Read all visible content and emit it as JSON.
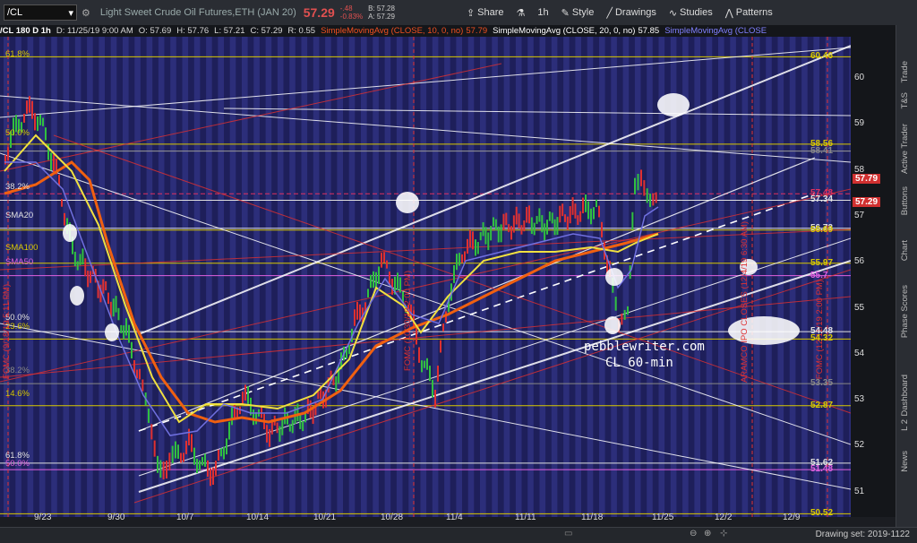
{
  "toolbar": {
    "symbol": "/CL",
    "description": "Light Sweet Crude Oil Futures,ETH (JAN 20)",
    "last": "57.29",
    "change": "-.48",
    "change_pct": "-0.83%",
    "bid": "B: 57.28",
    "ask": "A: 57.29",
    "share": "Share",
    "timeframe": "1h",
    "style": "Style",
    "drawings": "Drawings",
    "studies": "Studies",
    "patterns": "Patterns"
  },
  "infobar": {
    "symbol_tf": "/CL 180 D 1h",
    "date": "D: 11/25/19 9:00 AM",
    "open": "O: 57.69",
    "high": "H: 57.76",
    "low": "L: 57.21",
    "close": "C: 57.29",
    "range": "R: 0.55",
    "sma10": "SimpleMovingAvg (CLOSE, 10, 0, no)",
    "sma10_val": "57.79",
    "sma20": "SimpleMovingAvg (CLOSE, 20, 0, no)",
    "sma20_val": "57.85",
    "sma_next": "SimpleMovingAvg (CLOSE"
  },
  "y_axis": [
    "60",
    "59",
    "58",
    "57",
    "56",
    "55",
    "54",
    "53",
    "52",
    "51"
  ],
  "price_flags": [
    {
      "text": "60.46",
      "color": "#d8c800"
    },
    {
      "text": "58.56",
      "color": "#d8c800"
    },
    {
      "text": "58.41",
      "color": "#888888"
    },
    {
      "text": "57.48",
      "color": "#e03060"
    },
    {
      "text": "57.34",
      "color": "#e0e0e0"
    },
    {
      "text": "57.79",
      "color": "#ffffff",
      "bg": "#d03030"
    },
    {
      "text": "57.29",
      "color": "#ffffff",
      "bg": "#d03030"
    },
    {
      "text": "56.73",
      "color": "#e0e0e0"
    },
    {
      "text": "56.69",
      "color": "#d8c800"
    },
    {
      "text": "55.97",
      "color": "#d8c800"
    },
    {
      "text": "55.7",
      "color": "#e060e0"
    },
    {
      "text": "54.48",
      "color": "#e0e0e0"
    },
    {
      "text": "54.32",
      "color": "#d8c800"
    },
    {
      "text": "53.35",
      "color": "#888888"
    },
    {
      "text": "52.87",
      "color": "#d8c800"
    },
    {
      "text": "51.62",
      "color": "#e0e0e0"
    },
    {
      "text": "51.48",
      "color": "#e060e0"
    },
    {
      "text": "50.52",
      "color": "#d8c800"
    }
  ],
  "x_axis": [
    "9/23",
    "9/30",
    "10/7",
    "10/14",
    "10/21",
    "10/28",
    "11/4",
    "11/11",
    "11/18",
    "11/25",
    "12/2",
    "12/9"
  ],
  "level_labels": [
    {
      "text": "61.8%",
      "color": "#d8c800"
    },
    {
      "text": "50.0%",
      "color": "#d8c800"
    },
    {
      "text": "38.2%",
      "color": "#e0e0e0"
    },
    {
      "text": "SMA20",
      "color": "#e0e0e0"
    },
    {
      "text": "SMA100",
      "color": "#d8c800"
    },
    {
      "text": "SMA50",
      "color": "#e060e0"
    },
    {
      "text": "50.0%",
      "color": "#e0e0e0"
    },
    {
      "text": "23.6%",
      "color": "#d8c800"
    },
    {
      "text": "38.2%",
      "color": "#888888"
    },
    {
      "text": "14.6%",
      "color": "#d8c800"
    },
    {
      "text": "61.8%",
      "color": "#e0e0e0"
    },
    {
      "text": "50.0%",
      "color": "#e060e0"
    }
  ],
  "event_labels": [
    "FOMC (9/18/19 5:11 PM)",
    "FOMC (10/30/19 2:00 PM)",
    "ARAMCO IPO CLOSES (12/4/19 6:30 AM)",
    "FOMC (12/11/19 2:00 PM)"
  ],
  "watermark": {
    "line1": "pebblewriter.com",
    "line2": "CL 60-min"
  },
  "right_tabs": [
    "Trade",
    "T&S",
    "Active Trader",
    "Buttons",
    "Chart",
    "Phase Scores",
    "Dashboard",
    "L 2",
    "News"
  ],
  "drawing_set": "Drawing set: 2019-1122",
  "colors": {
    "background": "#1e1f5a",
    "stripe": "#2c2e7a",
    "price_red": "#d03030",
    "fib_yellow": "#d8c800",
    "sma_yellow": "#f0e040",
    "sma_orange": "#f06010",
    "sma_blue": "#7070e0"
  }
}
